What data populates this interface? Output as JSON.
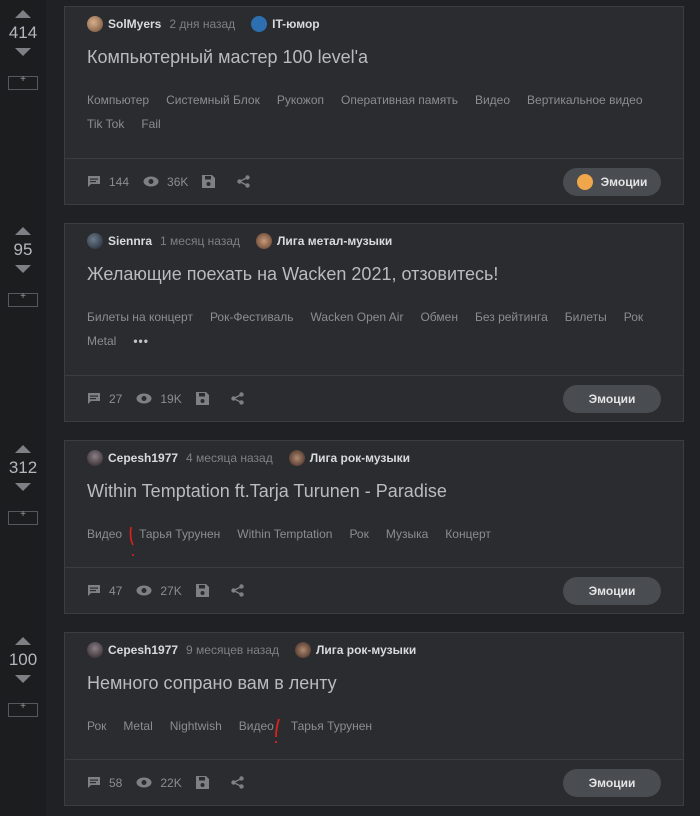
{
  "posts": [
    {
      "rating": "414",
      "author": "SolMyers",
      "time": "2 дня назад",
      "community": "IT-юмор",
      "title": "Компьютерный мастер 100 level'a",
      "tags": [
        "Компьютер",
        "Системный Блок",
        "Рукожоп",
        "Оперативная память",
        "Видео",
        "Вертикальное видео",
        "Tik Tok",
        "Fail"
      ],
      "comments": "144",
      "views": "36K",
      "emotions_label": "Эмоции"
    },
    {
      "rating": "95",
      "author": "Siennra",
      "time": "1 месяц назад",
      "community": "Лига метал-музыки",
      "title": "Желающие поехать на Wacken 2021, отзовитесь!",
      "tags": [
        "Билеты на концерт",
        "Рок-Фестиваль",
        "Wacken Open Air",
        "Обмен",
        "Без рейтинга",
        "Билеты",
        "Рок",
        "Metal"
      ],
      "more": "•••",
      "comments": "27",
      "views": "19K",
      "emotions_label": "Эмоции"
    },
    {
      "rating": "312",
      "author": "Cepesh1977",
      "time": "4 месяца назад",
      "community": "Лига рок-музыки",
      "title": "Within Temptation ft.Tarja Turunen - Paradise",
      "tags": [
        "Видео",
        "Тарья Турунен",
        "Within Temptation",
        "Рок",
        "Музыка",
        "Концерт"
      ],
      "comments": "47",
      "views": "27K",
      "emotions_label": "Эмоции"
    },
    {
      "rating": "100",
      "author": "Cepesh1977",
      "time": "9 месяцев назад",
      "community": "Лига рок-музыки",
      "title": "Немного сопрано вам в ленту",
      "tags": [
        "Рок",
        "Metal",
        "Nightwish",
        "Видео",
        "Тарья Турунен"
      ],
      "comments": "58",
      "views": "22K",
      "emotions_label": "Эмоции"
    }
  ],
  "colors": {
    "background": "#202124",
    "card": "#2a2c2f",
    "accent_red": "#e02020"
  }
}
